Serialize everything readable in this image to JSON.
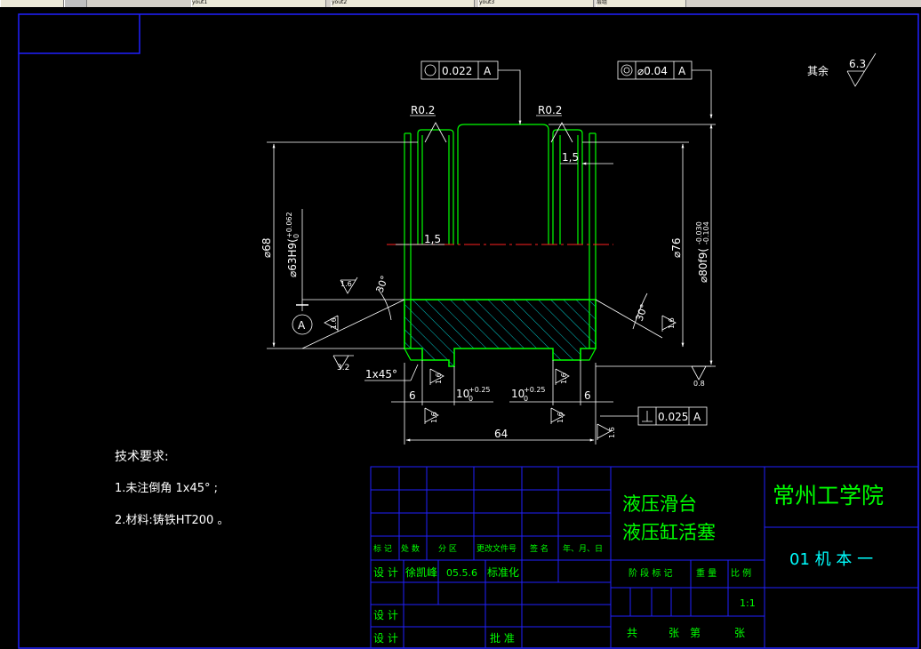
{
  "tabs": [
    "",
    "yout1",
    "yout2",
    "yout3",
    "层组"
  ],
  "gdt_top_left": {
    "tolerance": "0.022",
    "datum": "A"
  },
  "gdt_top_right": {
    "tolerance": "⌀0.04",
    "datum": "A"
  },
  "gdt_bottom_right": {
    "tolerance": "0.025",
    "datum": "A"
  },
  "surface_default": {
    "prefix": "其余",
    "value": "6.3"
  },
  "dims": {
    "r_left": "R0.2",
    "r_right": "R0.2",
    "w_right_groove": "1,5",
    "w_left_groove": "1,5",
    "d68": "⌀68",
    "d63": "⌀63H9(",
    "d63_tol": "+0.062",
    "d63_tol_low": "0",
    "d76": "⌀76",
    "d80": "⌀80f9(",
    "d80_tol": "-0.030",
    "d80_tol_low": "-0.104",
    "angle_left": "30°",
    "angle_right": "30°",
    "chamfer": "1x45°",
    "six_left": "6",
    "six_right": "6",
    "ten_left": "10",
    "ten_right": "10",
    "ten_tol_up": "+0.25",
    "ten_tol_low": "0",
    "total_len": "64",
    "datum_a": "A"
  },
  "roughness": [
    "1.6",
    "1.6",
    "1.6",
    "1.6",
    "1.6",
    "1.6",
    "1.6",
    "1.6",
    "3.2",
    "0.8"
  ],
  "notes": {
    "heading": "技术要求:",
    "line1": "1.未注倒角 1x45° ;",
    "line2": "2.材料:铸铁HT200 。"
  },
  "title_block": {
    "part_name_1": "液压滑台",
    "part_name_2": "液压缸活塞",
    "school": "常州工学院",
    "class": "01 机 本 一",
    "header_cols": [
      "标 记",
      "处 数",
      "分  区",
      "更改文件号",
      "签  名",
      "年、月、日"
    ],
    "designer_label": "设 计",
    "designer_name": "徐凯峰",
    "date": "05.5.6",
    "standardize": "标准化",
    "stage_label": "阶 段 标 记",
    "weight_label": "重  量",
    "scale_label": "比  例",
    "scale_value": "1:1",
    "row_label_2": "设 计",
    "row_label_3": "设 计",
    "approve": "批 准",
    "sheets_total": "共",
    "sheets_zhang": "张",
    "sheets_di": "第",
    "sheets_zhang2": "张"
  },
  "colors": {
    "background": "#000000",
    "part_outline": "#00ff00",
    "hatch": "#00c8c8",
    "center_mark": "#ff2020",
    "frame": "#2020ff",
    "annotation": "#ffffff",
    "title_text": "#00ff00",
    "school_text": "#00ffff"
  }
}
